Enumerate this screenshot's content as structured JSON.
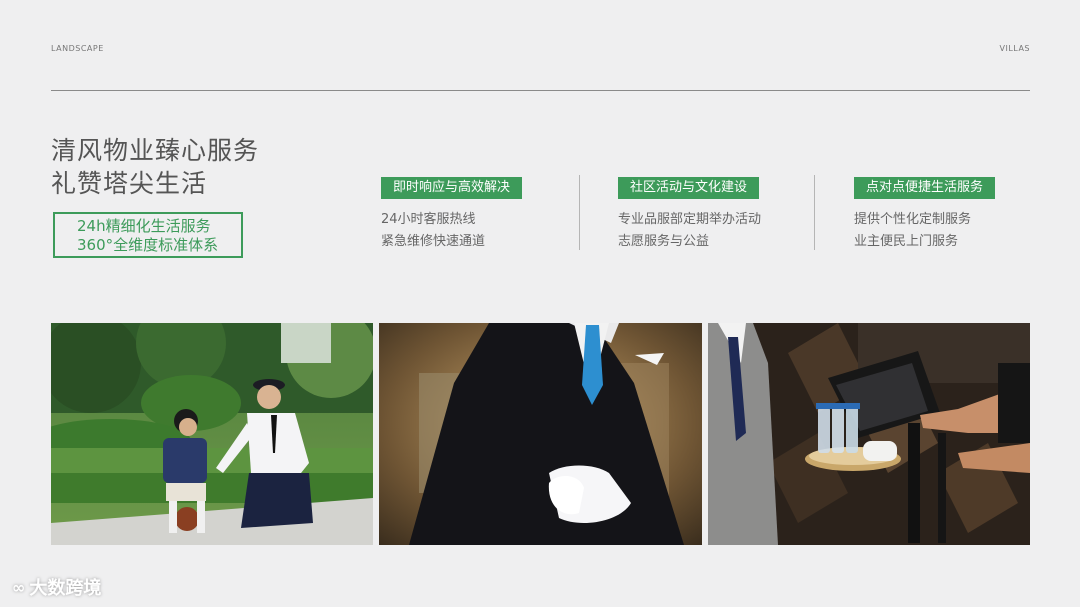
{
  "header": {
    "left_label": "LANDSCAPE",
    "right_label": "VILLAS"
  },
  "title": {
    "line1": "清风物业臻心服务",
    "line2": "礼赞塔尖生活"
  },
  "highlight": {
    "line1": "24h精细化生活服务",
    "line2": "360°全维度标准体系"
  },
  "features": [
    {
      "tag": "即时响应与高效解决",
      "lines": [
        "24小时客服热线",
        "紧急维修快速通道"
      ]
    },
    {
      "tag": "社区活动与文化建设",
      "lines": [
        "专业品服部定期举办活动",
        "志愿服务与公益"
      ]
    },
    {
      "tag": "点对点便捷生活服务",
      "lines": [
        "提供个性化定制服务",
        "业主便民上门服务"
      ]
    }
  ],
  "watermark": {
    "text": "大数跨境"
  },
  "colors": {
    "accent": "#3d9b5a",
    "background": "#efeff0"
  }
}
